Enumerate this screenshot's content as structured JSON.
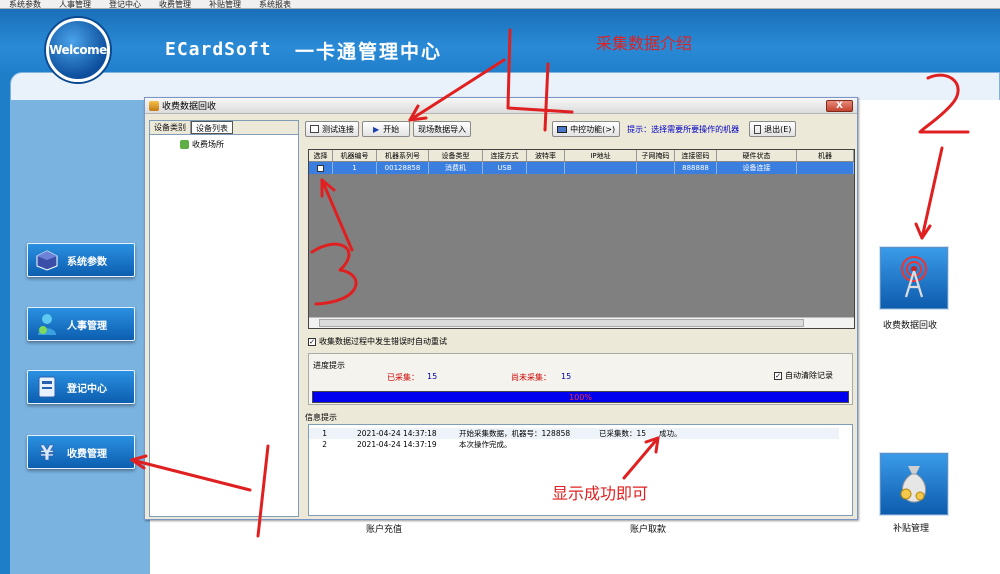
{
  "menu": [
    "系统参数",
    "人事管理",
    "登记中心",
    "收费管理",
    "补贴管理",
    "系统报表"
  ],
  "header": {
    "welcome": "Welcome",
    "brand": "ECardSoft",
    "title": "一卡通管理中心"
  },
  "side_nav": [
    {
      "label": "系统参数",
      "icon": "cube-icon"
    },
    {
      "label": "人事管理",
      "icon": "person-icon"
    },
    {
      "label": "登记中心",
      "icon": "id-card-icon"
    },
    {
      "label": "收费管理",
      "icon": "yen-icon"
    }
  ],
  "right_icons": [
    {
      "label": "收费数据回收",
      "icon": "antenna-tower-icon"
    },
    {
      "label": "补贴管理",
      "icon": "money-bag-icon"
    }
  ],
  "bottom_labels": [
    "账户充值",
    "账户取款"
  ],
  "dialog": {
    "title": "收费数据回收",
    "close": "X",
    "tree_tabs": [
      "设备类别",
      "设备列表"
    ],
    "tree_node": "收费场所",
    "toolbar": {
      "test": "测试连接",
      "start": "开始",
      "import": "现场数据导入",
      "extra": "中控功能(>)",
      "hint": "提示：选择需要所要操作的机器",
      "exit": "退出(E)"
    },
    "grid": {
      "columns": [
        "选择",
        "机器编号",
        "机器系列号",
        "设备类型",
        "连接方式",
        "波特率",
        "IP地址",
        "子网掩码",
        "连接密码",
        "硬件状态",
        "机器"
      ],
      "rows": [
        [
          "",
          "1",
          "00128858",
          "消费机",
          "USB",
          "",
          "",
          "",
          "888888",
          "设备连接",
          ""
        ]
      ]
    },
    "auto_check": "收集数据过程中发生错误时自动重试",
    "progress": {
      "title": "进度提示",
      "collected_label": "已采集：",
      "collected": "15",
      "remaining_label": "尚未采集：",
      "remaining": "15",
      "auto_clear": "自动清除记录",
      "percent": "100%",
      "value": 1.0
    },
    "info_label": "信息提示",
    "info_rows": [
      [
        "1",
        "2021-04-24 14:37:18",
        "开始采集数据，机器号：128858",
        "已采集数：15",
        "成功。"
      ],
      [
        "2",
        "2021-04-24 14:37:19",
        "本次操作完成。",
        "",
        ""
      ]
    ]
  },
  "annotations": {
    "title": "采集数据介绍",
    "success": "显示成功即可",
    "n1": "1",
    "n2": "2",
    "n3": "3",
    "n4": "4"
  }
}
